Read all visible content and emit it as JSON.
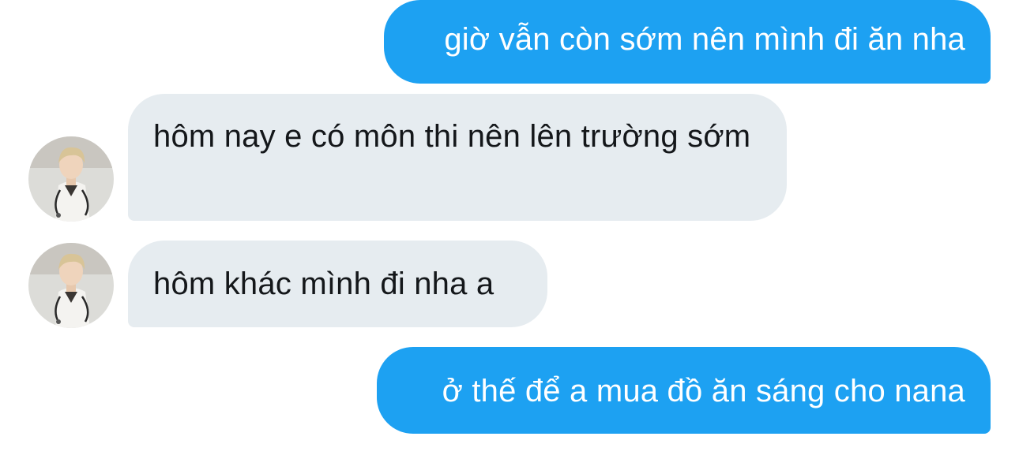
{
  "conversation": {
    "messages": [
      {
        "direction": "outgoing",
        "text": "giờ vẫn còn sớm nên mình đi ăn nha"
      },
      {
        "direction": "incoming",
        "text": "hôm nay e có môn thi nên lên trường sớm",
        "avatar": "doctor-photo-avatar"
      },
      {
        "direction": "incoming",
        "text": "hôm khác mình đi nha a",
        "avatar": "doctor-photo-avatar"
      },
      {
        "direction": "outgoing",
        "text": "ở thế để a mua đồ ăn sáng cho nana"
      }
    ]
  },
  "colors": {
    "outgoing_bubble": "#1da1f2",
    "incoming_bubble": "#e6ecf0",
    "incoming_text": "#14171a",
    "outgoing_text": "#ffffff"
  }
}
